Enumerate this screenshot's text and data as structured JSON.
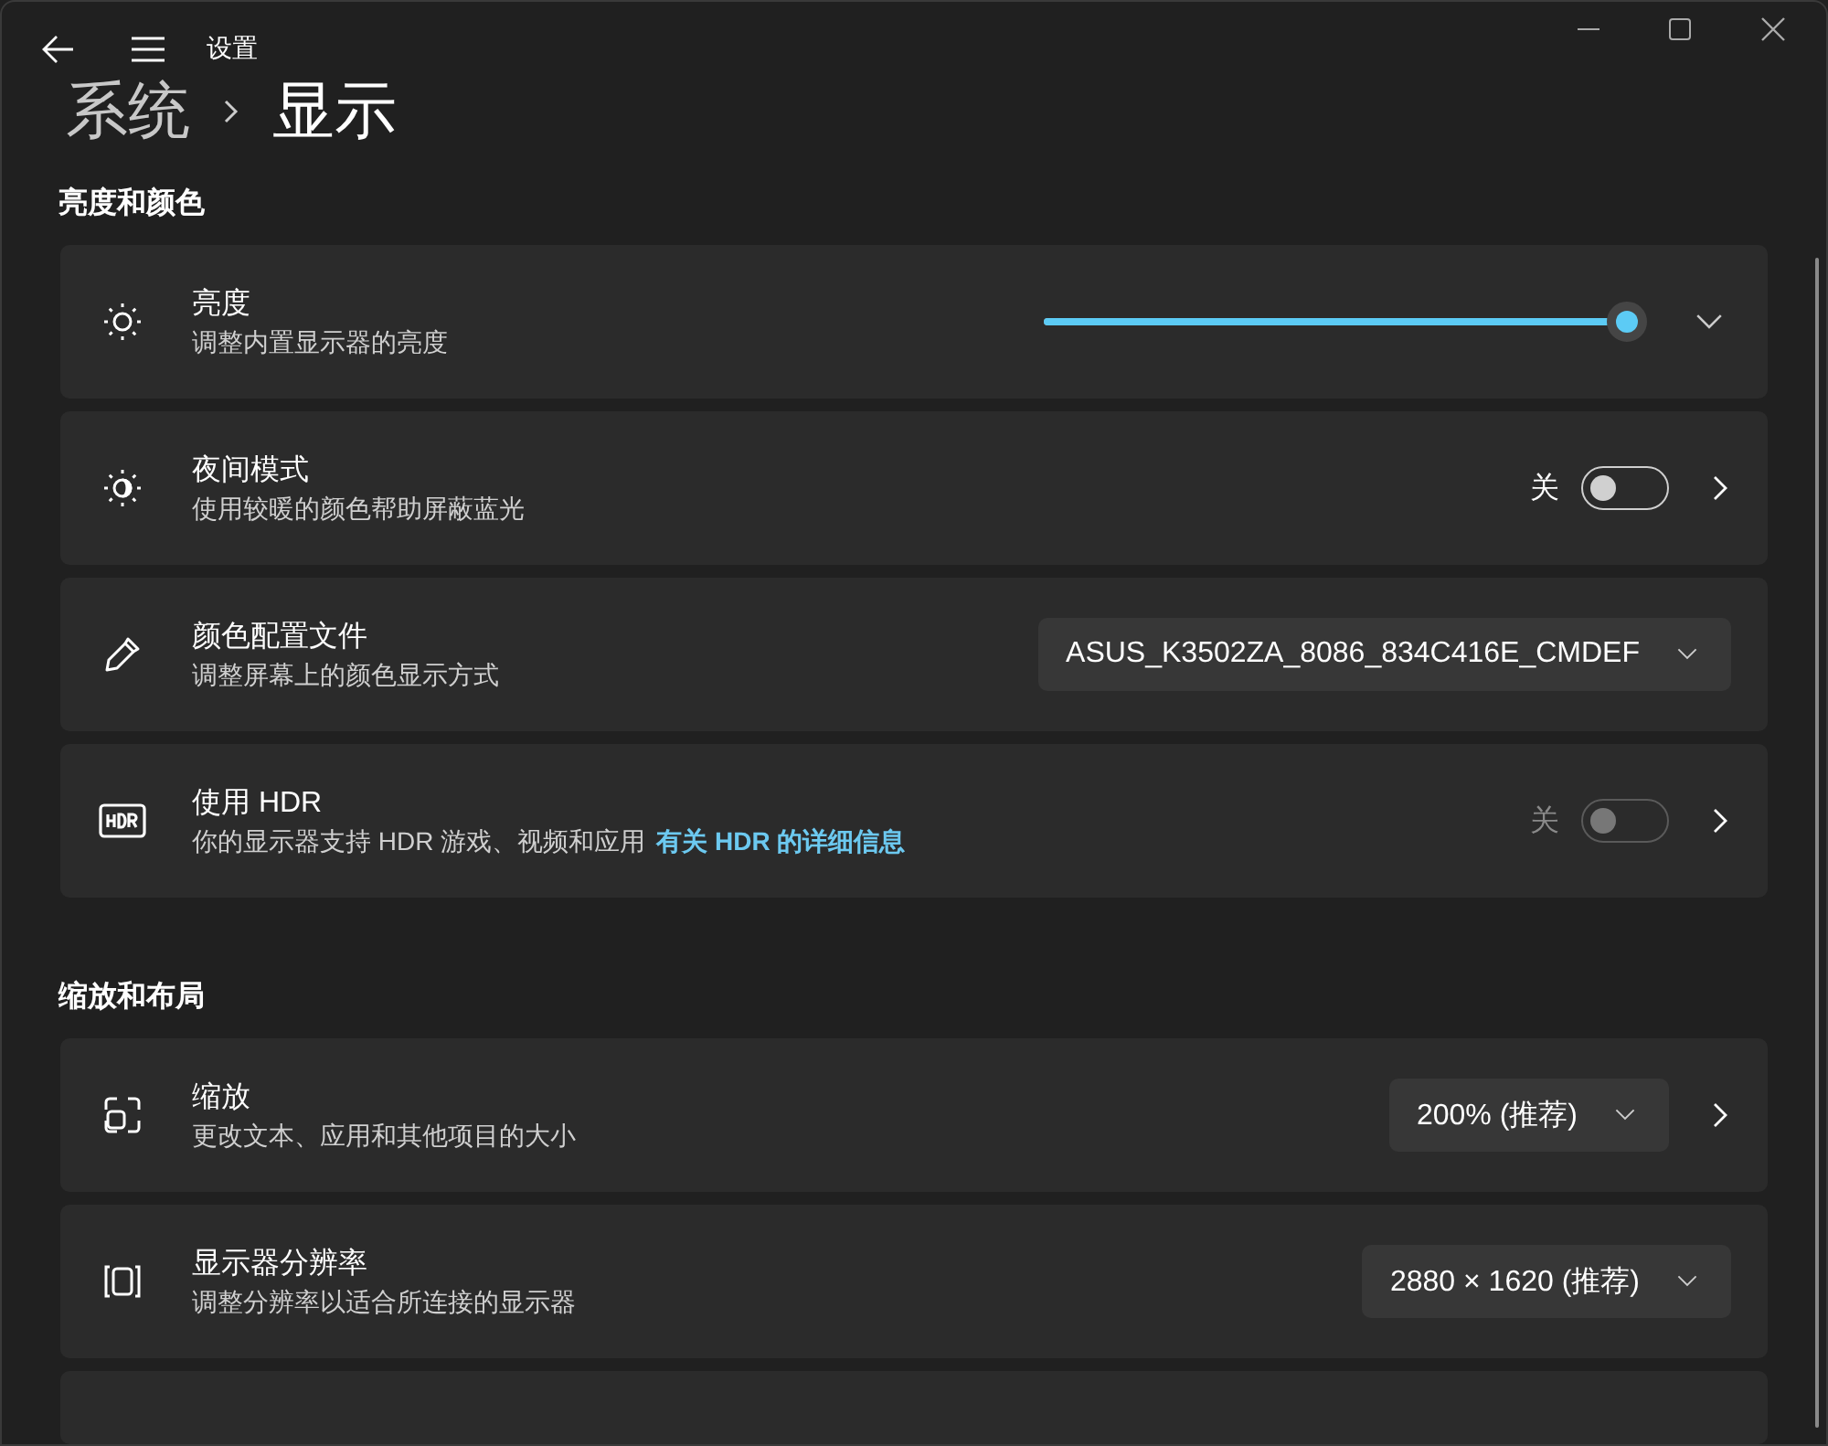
{
  "window": {
    "title": "设置"
  },
  "breadcrumb": [
    {
      "label": "系统",
      "selected": false
    },
    {
      "label": "显示",
      "selected": true
    }
  ],
  "sections": [
    {
      "title": "亮度和颜色",
      "rows": [
        {
          "kind": "slider",
          "title": "亮度",
          "description": "调整内置显示器的亮度",
          "level": 0.98,
          "expanded": false
        },
        {
          "kind": "toggle",
          "title": "夜间模式",
          "description": "使用较暖的颜色帮助屏蔽蓝光",
          "state_label": "关",
          "on": false,
          "disabled": false,
          "navigates": true
        },
        {
          "kind": "dropdown",
          "title": "颜色配置文件",
          "description": "调整屏幕上的颜色显示方式",
          "value": "ASUS_K3502ZA_8086_834C416E_CMDEF",
          "navigates": false
        },
        {
          "kind": "toggle",
          "title": "使用 HDR",
          "description": "你的显示器支持 HDR 游戏、视频和应用",
          "link": "有关 HDR 的详细信息",
          "state_label": "关",
          "on": false,
          "disabled": true,
          "navigates": true
        }
      ]
    },
    {
      "title": "缩放和布局",
      "rows": [
        {
          "kind": "dropdown",
          "title": "缩放",
          "description": "更改文本、应用和其他项目的大小",
          "value": "200% (推荐)",
          "navigates": true
        },
        {
          "kind": "dropdown",
          "title": "显示器分辨率",
          "description": "调整分辨率以适合所连接的显示器",
          "value": "2880 × 1620 (推荐)",
          "navigates": false
        }
      ]
    }
  ]
}
